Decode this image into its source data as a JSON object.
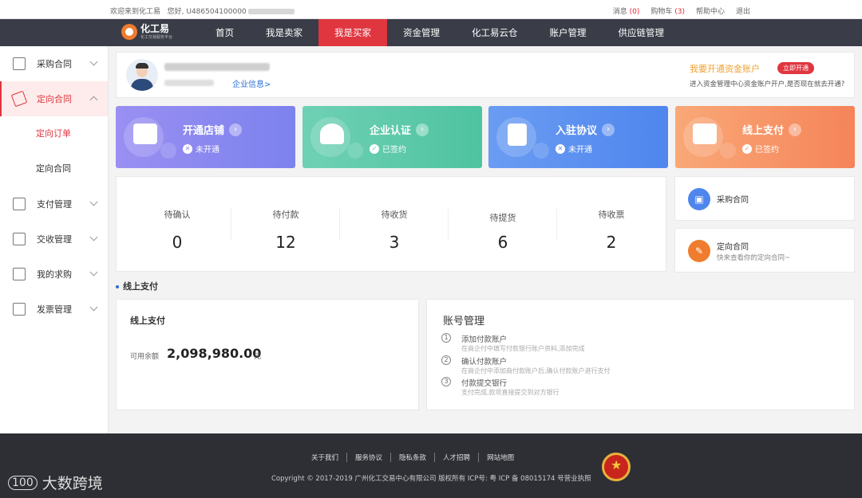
{
  "topbar": {
    "welcome": "欢迎来到化工易",
    "hello": "您好,",
    "user_id": "U486504100000",
    "messages_label": "消息",
    "messages_count": "(0)",
    "cart_label": "购物车",
    "cart_count": "(3)",
    "help": "帮助中心",
    "logout": "退出"
  },
  "logo": {
    "name": "化工易",
    "tagline": "化工交易服务平台"
  },
  "nav": [
    "首页",
    "我是卖家",
    "我是买家",
    "资金管理",
    "化工易云仓",
    "账户管理",
    "供应链管理"
  ],
  "sidebar": {
    "items": [
      {
        "label": "采购合同"
      },
      {
        "label": "定向合同"
      },
      {
        "label": "定向订单"
      },
      {
        "label": "定向合同"
      },
      {
        "label": "支付管理"
      },
      {
        "label": "交收管理"
      },
      {
        "label": "我的求购"
      },
      {
        "label": "发票管理"
      }
    ]
  },
  "profile": {
    "company_link": "企业信息>",
    "promo_title": "我要开通资金账户",
    "promo_button": "立即开通",
    "promo_sub": "进入资金管理中心资金账户开户,是否现在就去开通?"
  },
  "tiles": [
    {
      "title": "开通店铺",
      "status": "未开通",
      "color": "#8c86f0"
    },
    {
      "title": "企业认证",
      "status": "已签约",
      "color": "#5ccba8"
    },
    {
      "title": "入驻协议",
      "status": "未开通",
      "color": "#5f8ff0"
    },
    {
      "title": "线上支付",
      "status": "已签约",
      "color": "#f7935c"
    }
  ],
  "stats": [
    {
      "label": "待确认",
      "value": "0"
    },
    {
      "label": "待付款",
      "value": "12"
    },
    {
      "label": "待收货",
      "value": "3"
    },
    {
      "label": "待提货",
      "value": "6"
    },
    {
      "label": "待收票",
      "value": "2"
    }
  ],
  "side_cards": {
    "purchase": {
      "title": "采购合同"
    },
    "directed": {
      "title": "定向合同",
      "sub": "快来查看你的定向合同~"
    }
  },
  "section_title": "线上支付",
  "payment": {
    "title": "线上支付",
    "balance_label": "可用余额",
    "balance": "2,098,980.00",
    "unit": "元"
  },
  "account": {
    "title": "账号管理",
    "steps": [
      {
        "num": "1",
        "title": "添加付款账户",
        "desc": "在商企付中填写付款银行账户资料,添加完成"
      },
      {
        "num": "2",
        "title": "确认付款账户",
        "desc": "在商企付中添加商付款账户后,确认付款账户进行支付"
      },
      {
        "num": "3",
        "title": "付款提交银行",
        "desc": "支付完成,款项直接提交到对方银行"
      }
    ]
  },
  "footer": {
    "links": [
      "关于我们",
      "服务协议",
      "隐私条款",
      "人才招聘",
      "网站地图"
    ],
    "copyright": "Copyright © 2017-2019 广州化工交易中心有限公司 版权所有 ICP号: 粤 ICP 备 08015174 号营业执照"
  },
  "watermark": {
    "mark": "100",
    "text": "大数跨境"
  }
}
